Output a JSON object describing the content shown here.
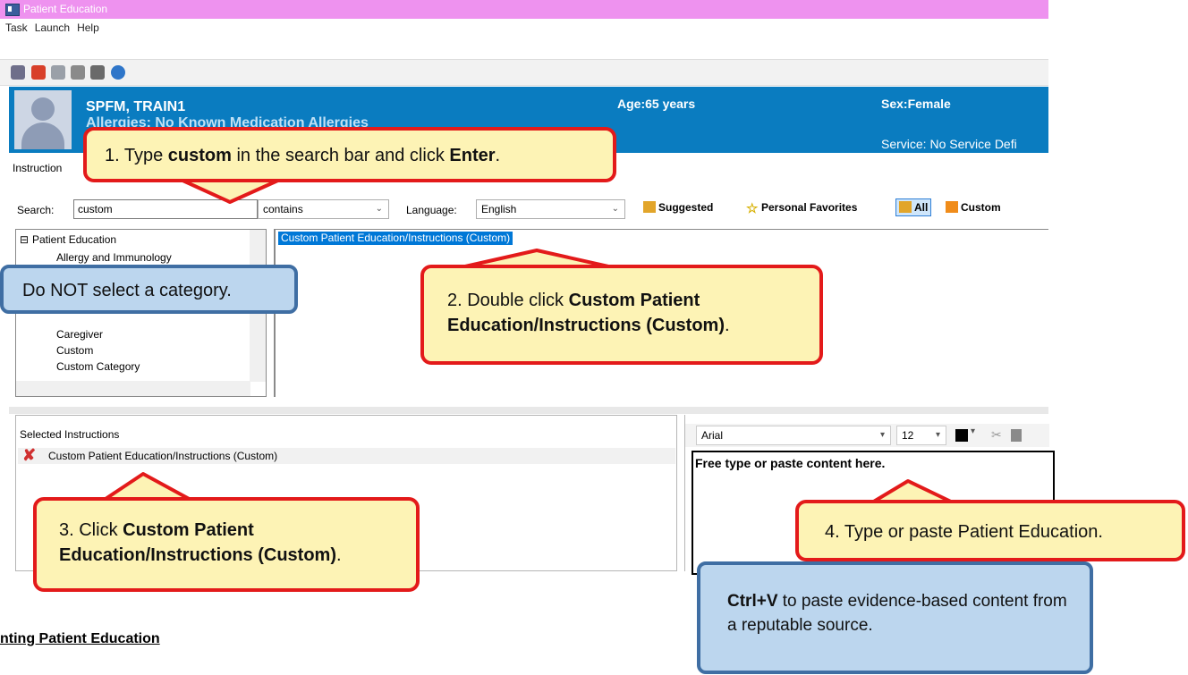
{
  "window": {
    "title": "Patient Education"
  },
  "menu": [
    "Task",
    "Launch",
    "Help"
  ],
  "toolbar_icons": [
    "print-icon",
    "lookup-icon",
    "copy-icon",
    "edit-icon",
    "insert-icon",
    "help-icon"
  ],
  "patient": {
    "name": "SPFM, TRAIN1",
    "allergy": "Allergies: No Known Medication Allergies",
    "age": "Age:65 years",
    "sex": "Sex:Female",
    "service": "Service: No Service Defi"
  },
  "instruction_tab": "Instruction",
  "search": {
    "label": "Search:",
    "value": "custom",
    "mode": "contains",
    "language_label": "Language:",
    "language": "English"
  },
  "filters": [
    "Suggested",
    "Personal Favorites",
    "All",
    "Custom"
  ],
  "tree": {
    "root": "Patient Education",
    "items": [
      "Allergy and Immunology",
      "Caregiver",
      "Custom",
      "Custom Category"
    ]
  },
  "results": [
    "Custom Patient Education/Instructions (Custom)"
  ],
  "selected": {
    "label": "Selected Instructions",
    "items": [
      "Custom Patient Education/Instructions (Custom)"
    ]
  },
  "editor": {
    "font": "Arial",
    "size": "12",
    "placeholder": "Free type or paste content here."
  },
  "bottom_heading": "nting Patient Education",
  "callouts": {
    "c1": {
      "pre": "1. Type ",
      "b1": "custom",
      "mid": " in the search bar and click ",
      "b2": "Enter",
      "post": "."
    },
    "c_blue_tree": "Do NOT select a category.",
    "c2": {
      "pre": "2. Double click ",
      "b1": "Custom Patient Education/Instructions (Custom)",
      "post": "."
    },
    "c3": {
      "pre": "3. Click ",
      "b1": "Custom Patient Education/Instructions (Custom)",
      "post": "."
    },
    "c4": "4. Type or paste Patient Education.",
    "c_blue_paste": {
      "b1": "Ctrl+V",
      "post": " to paste evidence-based content from a reputable source."
    }
  },
  "colors": {
    "titlebar": "#ee92ef",
    "patient_banner": "#0a7cc0",
    "callout_border": "#e31a1a",
    "callout_fill": "#fdf3b5",
    "note_border": "#3f6ea3",
    "note_fill": "#bcd6ee"
  }
}
